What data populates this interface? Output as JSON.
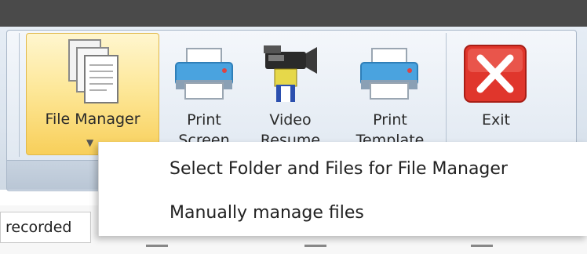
{
  "ribbon": {
    "buttons": {
      "file_manager": "File Manager",
      "print_screen_line1": "Print",
      "print_screen_line2": "Screen",
      "video_resume_line1": "Video",
      "video_resume_line2": "Resume",
      "print_template_line1": "Print",
      "print_template_line2": "Template",
      "exit": "Exit"
    }
  },
  "dropdown_menu": {
    "items": [
      {
        "label": "Select Folder and Files for File Manager"
      },
      {
        "label": "Manually manage files"
      }
    ]
  },
  "statusbar": {
    "field_text": "recorded"
  },
  "icons": {
    "file_manager": "documents-icon",
    "print_screen": "printer-icon",
    "video_resume": "video-camera-icon",
    "print_template": "printer-icon",
    "exit": "close-icon"
  },
  "colors": {
    "titlebar": "#4a4a4a",
    "active_button": "#fde89a",
    "exit_red": "#e0362c"
  }
}
